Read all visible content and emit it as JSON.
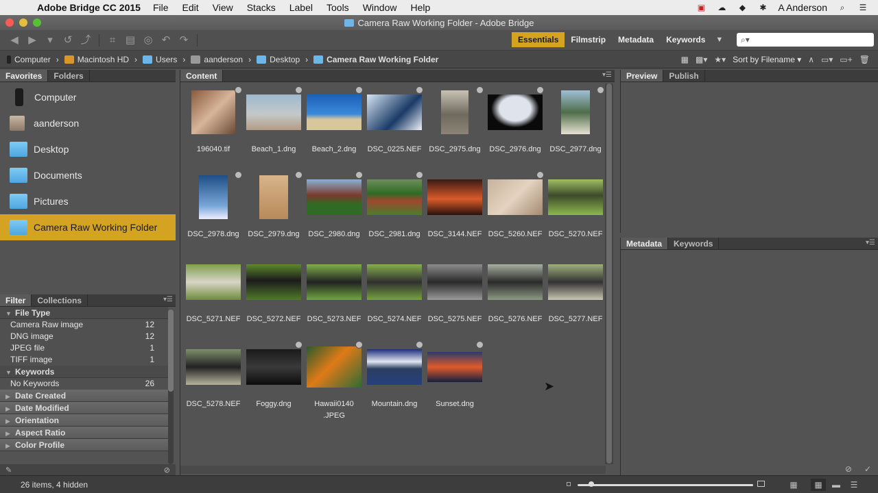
{
  "menubar": {
    "app_name": "Adobe Bridge CC 2015",
    "menus": [
      "File",
      "Edit",
      "View",
      "Stacks",
      "Label",
      "Tools",
      "Window",
      "Help"
    ],
    "user": "A Anderson"
  },
  "window": {
    "title": "Camera Raw Working Folder - Adobe Bridge"
  },
  "workspaces": {
    "items": [
      "Essentials",
      "Filmstrip",
      "Metadata",
      "Keywords"
    ],
    "active": "Essentials"
  },
  "search": {
    "placeholder": ""
  },
  "path": {
    "crumbs": [
      "Computer",
      "Macintosh HD",
      "Users",
      "aanderson",
      "Desktop",
      "Camera Raw Working Folder"
    ],
    "sort_label": "Sort by Filename"
  },
  "left_top": {
    "tabs": [
      "Favorites",
      "Folders"
    ],
    "items": [
      "Computer",
      "aanderson",
      "Desktop",
      "Documents",
      "Pictures",
      "Camera Raw Working Folder"
    ],
    "selected": "Camera Raw Working Folder"
  },
  "left_bottom": {
    "tabs": [
      "Filter",
      "Collections"
    ],
    "file_type": {
      "label": "File Type",
      "rows": [
        {
          "name": "Camera Raw image",
          "count": "12"
        },
        {
          "name": "DNG image",
          "count": "12"
        },
        {
          "name": "JPEG file",
          "count": "1"
        },
        {
          "name": "TIFF image",
          "count": "1"
        }
      ]
    },
    "keywords": {
      "label": "Keywords",
      "rows": [
        {
          "name": "No Keywords",
          "count": "26"
        }
      ]
    },
    "collapsed_groups": [
      "Date Created",
      "Date Modified",
      "Orientation",
      "Aspect Ratio",
      "Color Profile"
    ]
  },
  "content": {
    "tab": "Content",
    "files": [
      "196040.tif",
      "Beach_1.dng",
      "Beach_2.dng",
      "DSC_0225.NEF",
      "DSC_2975.dng",
      "DSC_2976.dng",
      "DSC_2977.dng",
      "DSC_2978.dng",
      "DSC_2979.dng",
      "DSC_2980.dng",
      "DSC_2981.dng",
      "DSC_3144.NEF",
      "DSC_5260.NEF",
      "DSC_5270.NEF",
      "DSC_5271.NEF",
      "DSC_5272.NEF",
      "DSC_5273.NEF",
      "DSC_5274.NEF",
      "DSC_5275.NEF",
      "DSC_5276.NEF",
      "DSC_5277.NEF",
      "DSC_5278.NEF",
      "Foggy.dng",
      "Hawaii0140\n.JPEG",
      "Mountain.dng",
      "Sunset.dng"
    ]
  },
  "right_top": {
    "tabs": [
      "Preview",
      "Publish"
    ]
  },
  "right_bottom": {
    "tabs": [
      "Metadata",
      "Keywords"
    ]
  },
  "status": {
    "item_count": "26 items, 4 hidden",
    "thumbnail_size": 0.08
  }
}
